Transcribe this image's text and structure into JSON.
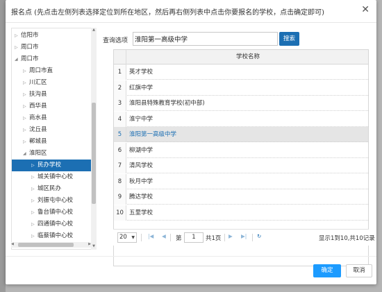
{
  "dialog": {
    "title": "报名点 (先点击左侧列表选择定位到所在地区，然后再右侧列表中点击你要报名的学校，点击确定即可)",
    "close_icon": "close-icon"
  },
  "tree": {
    "items": [
      {
        "label": "信阳市",
        "depth": 0,
        "expanded": false
      },
      {
        "label": "周口市",
        "depth": 0,
        "expanded": false
      },
      {
        "label": "周口市",
        "depth": 0,
        "expanded": true
      },
      {
        "label": "周口市直",
        "depth": 1,
        "expanded": false
      },
      {
        "label": "川汇区",
        "depth": 1,
        "expanded": false
      },
      {
        "label": "扶沟县",
        "depth": 1,
        "expanded": false
      },
      {
        "label": "西华县",
        "depth": 1,
        "expanded": false
      },
      {
        "label": "商水县",
        "depth": 1,
        "expanded": false
      },
      {
        "label": "沈丘县",
        "depth": 1,
        "expanded": false
      },
      {
        "label": "郸城县",
        "depth": 1,
        "expanded": false
      },
      {
        "label": "淮阳区",
        "depth": 1,
        "expanded": true
      },
      {
        "label": "民办学校",
        "depth": 2,
        "expanded": false,
        "selected": true
      },
      {
        "label": "城关镇中心校",
        "depth": 2,
        "expanded": false
      },
      {
        "label": "城区民办",
        "depth": 2,
        "expanded": false
      },
      {
        "label": "刘振屯中心校",
        "depth": 2,
        "expanded": false
      },
      {
        "label": "鲁台镇中心校",
        "depth": 2,
        "expanded": false
      },
      {
        "label": "四通镇中心校",
        "depth": 2,
        "expanded": false
      },
      {
        "label": "临蔡镇中心校",
        "depth": 2,
        "expanded": false
      }
    ]
  },
  "search": {
    "label": "查询选项",
    "value": "淮阳第一高级中学",
    "button_label": "搜索"
  },
  "grid": {
    "column_header": "学校名称",
    "rows": [
      {
        "num": "1",
        "name": "英才学校"
      },
      {
        "num": "2",
        "name": "红旗中学"
      },
      {
        "num": "3",
        "name": "淮阳县特殊教育学校(初中部)"
      },
      {
        "num": "4",
        "name": "淮宁中学"
      },
      {
        "num": "5",
        "name": "淮阳第一高级中学",
        "highlighted": true
      },
      {
        "num": "6",
        "name": "柳湖中学"
      },
      {
        "num": "7",
        "name": "清风学校"
      },
      {
        "num": "8",
        "name": "秋月中学"
      },
      {
        "num": "9",
        "name": "腾达学校"
      },
      {
        "num": "10",
        "name": "五里学校"
      }
    ]
  },
  "pager": {
    "page_size": "20",
    "page_prefix": "第",
    "page_value": "1",
    "page_suffix": "共1页",
    "summary": "显示1到10,共10记录"
  },
  "footer": {
    "ok_label": "确定",
    "cancel_label": "取消"
  },
  "colors": {
    "accent": "#1c6fb3",
    "ok_button": "#1c9bff"
  }
}
